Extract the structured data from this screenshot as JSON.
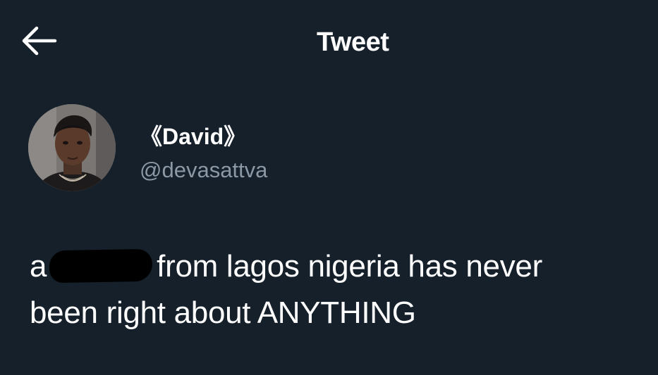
{
  "header": {
    "back_icon": "arrow-left-icon",
    "title": "Tweet"
  },
  "author": {
    "avatar": "profile-photo",
    "display_name": "《David》",
    "handle": "@devasattva"
  },
  "tweet": {
    "line1_before": "a",
    "line1_after": "from lagos nigeria has never",
    "line2": "been right about ANYTHING"
  },
  "colors": {
    "background": "#15202b",
    "text": "#ffffff",
    "secondary_text": "#8b98a5"
  }
}
